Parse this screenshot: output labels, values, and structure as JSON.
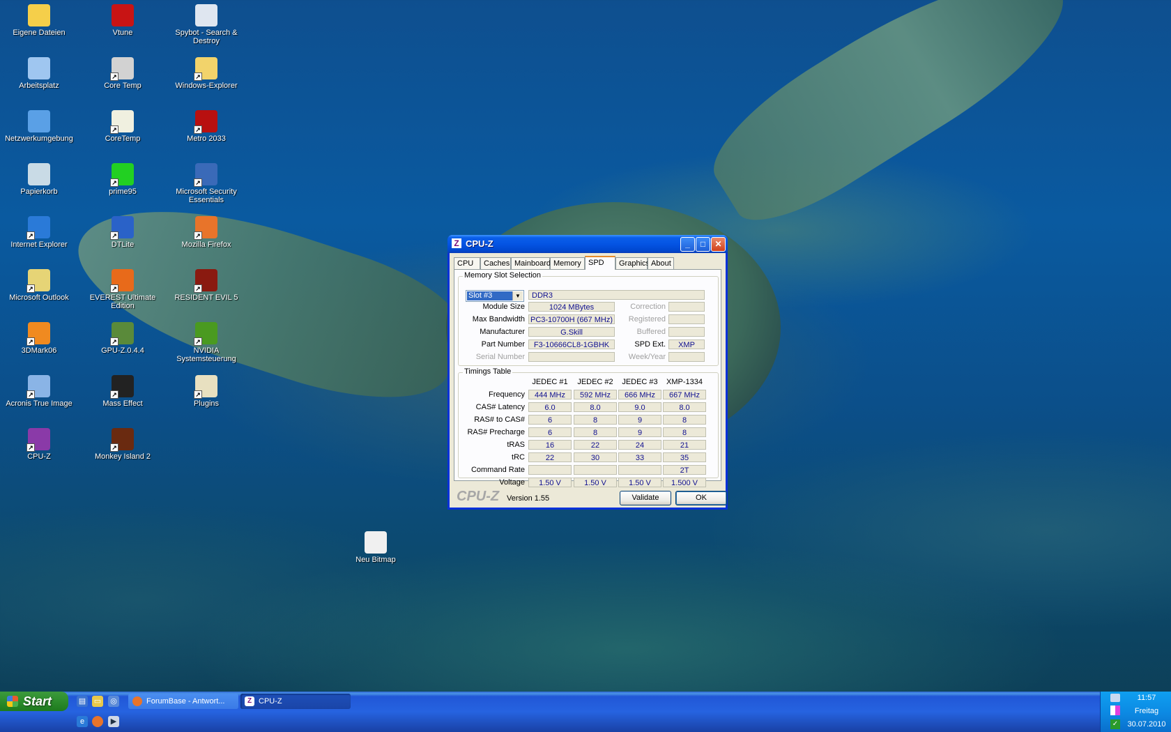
{
  "desktop_icons": [
    {
      "label": "Eigene Dateien",
      "icon": "folder-icon",
      "color": "#f5cf4a"
    },
    {
      "label": "Vtune",
      "icon": "vtune-icon",
      "color": "#c81414"
    },
    {
      "label": "Spybot - Search & Destroy",
      "icon": "spybot-icon",
      "color": "#dfe6f0"
    },
    {
      "label": "Arbeitsplatz",
      "icon": "computer-icon",
      "color": "#9fc6f0"
    },
    {
      "label": "Core Temp",
      "icon": "thermometer-icon",
      "color": "#d2d2d2"
    },
    {
      "label": "Windows-Explorer",
      "icon": "explorer-icon",
      "color": "#f2d36b"
    },
    {
      "label": "Netzwerkumgebung",
      "icon": "network-icon",
      "color": "#5aa0e6"
    },
    {
      "label": "CoreTemp",
      "icon": "notepad-icon",
      "color": "#f0f0e0"
    },
    {
      "label": "Metro 2033",
      "icon": "metro-icon",
      "color": "#b81010"
    },
    {
      "label": "Papierkorb",
      "icon": "recycle-bin-icon",
      "color": "#c9dbe6"
    },
    {
      "label": "prime95",
      "icon": "prime95-icon",
      "color": "#22d022"
    },
    {
      "label": "Microsoft Security Essentials",
      "icon": "security-icon",
      "color": "#3a6ab8"
    },
    {
      "label": "Internet Explorer",
      "icon": "ie-icon",
      "color": "#2a7ad8"
    },
    {
      "label": "DTLite",
      "icon": "dtlite-icon",
      "color": "#2a62c8"
    },
    {
      "label": "Mozilla Firefox",
      "icon": "firefox-icon",
      "color": "#e8742a"
    },
    {
      "label": "Microsoft Outlook",
      "icon": "outlook-icon",
      "color": "#e6d476"
    },
    {
      "label": "EVEREST Ultimate Edition",
      "icon": "everest-icon",
      "color": "#e86a1a"
    },
    {
      "label": "RESIDENT EVIL 5",
      "icon": "re5-icon",
      "color": "#8a1a10"
    },
    {
      "label": "3DMark06",
      "icon": "3dmark-icon",
      "color": "#f08a20"
    },
    {
      "label": "GPU-Z.0.4.4",
      "icon": "gpuz-icon",
      "color": "#5a8a3a"
    },
    {
      "label": "NVIDIA Systemsteuerung",
      "icon": "nvidia-icon",
      "color": "#4a9a20"
    },
    {
      "label": "Acronis True Image",
      "icon": "acronis-icon",
      "color": "#8ab4e6"
    },
    {
      "label": "Mass Effect",
      "icon": "masseffect-icon",
      "color": "#222222"
    },
    {
      "label": "Plugins",
      "icon": "plugins-icon",
      "color": "#e8e0c0"
    },
    {
      "label": "CPU-Z",
      "icon": "cpuz-icon",
      "color": "#8a3aa8"
    },
    {
      "label": "Monkey Island 2",
      "icon": "monkey-island-icon",
      "color": "#6a2a10"
    },
    {
      "label": "Neu Bitmap",
      "icon": "bitmap-icon",
      "color": "#f0f0f0"
    }
  ],
  "window": {
    "title": "CPU-Z",
    "tabs": [
      "CPU",
      "Caches",
      "Mainboard",
      "Memory",
      "SPD",
      "Graphics",
      "About"
    ],
    "active_tab": "SPD",
    "slot_group_title": "Memory Slot Selection",
    "slot_selected": "Slot #3",
    "memory_type": "DDR3",
    "left_fields": [
      {
        "label": "Module Size",
        "value": "1024 MBytes"
      },
      {
        "label": "Max Bandwidth",
        "value": "PC3-10700H (667 MHz)"
      },
      {
        "label": "Manufacturer",
        "value": "G.Skill"
      },
      {
        "label": "Part Number",
        "value": "F3-10666CL8-1GBHK"
      },
      {
        "label": "Serial Number",
        "value": ""
      }
    ],
    "right_fields": [
      {
        "label": "Correction",
        "value": ""
      },
      {
        "label": "Registered",
        "value": ""
      },
      {
        "label": "Buffered",
        "value": ""
      },
      {
        "label": "SPD Ext.",
        "value": "XMP"
      },
      {
        "label": "Week/Year",
        "value": ""
      }
    ],
    "timings_title": "Timings Table",
    "timing_columns": [
      "JEDEC #1",
      "JEDEC #2",
      "JEDEC #3",
      "XMP-1334"
    ],
    "timing_rows": [
      {
        "label": "Frequency",
        "values": [
          "444 MHz",
          "592 MHz",
          "666 MHz",
          "667 MHz"
        ]
      },
      {
        "label": "CAS# Latency",
        "values": [
          "6.0",
          "8.0",
          "9.0",
          "8.0"
        ]
      },
      {
        "label": "RAS# to CAS#",
        "values": [
          "6",
          "8",
          "9",
          "8"
        ]
      },
      {
        "label": "RAS# Precharge",
        "values": [
          "6",
          "8",
          "9",
          "8"
        ]
      },
      {
        "label": "tRAS",
        "values": [
          "16",
          "22",
          "24",
          "21"
        ]
      },
      {
        "label": "tRC",
        "values": [
          "22",
          "30",
          "33",
          "35"
        ]
      },
      {
        "label": "Command Rate",
        "values": [
          "",
          "",
          "",
          "2T"
        ]
      },
      {
        "label": "Voltage",
        "values": [
          "1.50 V",
          "1.50 V",
          "1.50 V",
          "1.500 V"
        ]
      }
    ],
    "footer_logo": "CPU-Z",
    "version": "Version 1.55",
    "validate_label": "Validate",
    "ok_label": "OK"
  },
  "taskbar": {
    "start_label": "Start",
    "tasks": [
      {
        "label": "ForumBase - Antwort...",
        "icon": "firefox-icon"
      },
      {
        "label": "CPU-Z",
        "icon": "cpuz-icon"
      }
    ],
    "clock_time": "11:57",
    "clock_day": "Freitag",
    "clock_date": "30.07.2010"
  }
}
